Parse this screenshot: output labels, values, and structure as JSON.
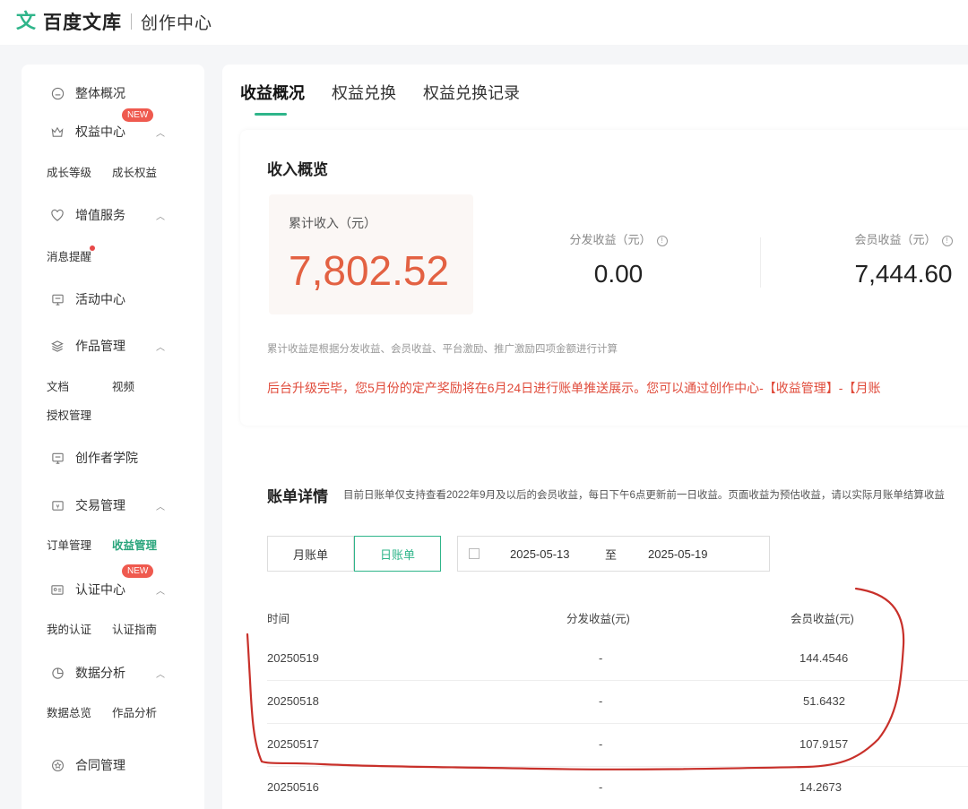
{
  "header": {
    "logo_mark": "文",
    "brand": "百度文库",
    "subtitle": "创作中心"
  },
  "sidebar": {
    "overview": "整体概况",
    "rights": {
      "label": "权益中心",
      "badge": "NEW",
      "subs": [
        "成长等级",
        "成长权益"
      ]
    },
    "value_added": {
      "label": "增值服务",
      "subs": [
        "消息提醒"
      ]
    },
    "activity": "活动中心",
    "works": {
      "label": "作品管理",
      "subs": [
        "文档",
        "视频",
        "授权管理"
      ]
    },
    "academy": "创作者学院",
    "trade": {
      "label": "交易管理",
      "subs": [
        "订单管理",
        "收益管理"
      ]
    },
    "cert": {
      "label": "认证中心",
      "badge": "NEW",
      "subs": [
        "我的认证",
        "认证指南"
      ]
    },
    "analysis": {
      "label": "数据分析",
      "subs": [
        "数据总览",
        "作品分析"
      ]
    },
    "contract": "合同管理"
  },
  "tabs": [
    "收益概况",
    "权益兑换",
    "权益兑换记录"
  ],
  "income": {
    "title": "收入概览",
    "total_label": "累计收入（元）",
    "total_value": "7,802.52",
    "dist_label": "分发收益（元）",
    "dist_value": "0.00",
    "member_label": "会员收益（元）",
    "member_value": "7,444.60",
    "note": "累计收益是根据分发收益、会员收益、平台激励、推广激励四项金额进行计算",
    "notice": "后台升级完毕，您5月份的定产奖励将在6月24日进行账单推送展示。您可以通过创作中心-【收益管理】-【月账"
  },
  "bill": {
    "title": "账单详情",
    "note": "目前日账单仅支持查看2022年9月及以后的会员收益，每日下午6点更新前一日收益。页面收益为预估收益，请以实际月账单结算收益",
    "monthly": "月账单",
    "daily": "日账单",
    "date_start": "2025-05-13",
    "date_to": "至",
    "date_end": "2025-05-19",
    "headers": [
      "时间",
      "分发收益(元)",
      "会员收益(元)"
    ],
    "rows": [
      [
        "20250519",
        "-",
        "144.4546"
      ],
      [
        "20250518",
        "-",
        "51.6432"
      ],
      [
        "20250517",
        "-",
        "107.9157"
      ],
      [
        "20250516",
        "-",
        "14.2673"
      ]
    ]
  },
  "colors": {
    "accent": "#2fb58a",
    "total": "#e36142",
    "notice": "#e04b3b",
    "annotation": "#c8302a"
  }
}
